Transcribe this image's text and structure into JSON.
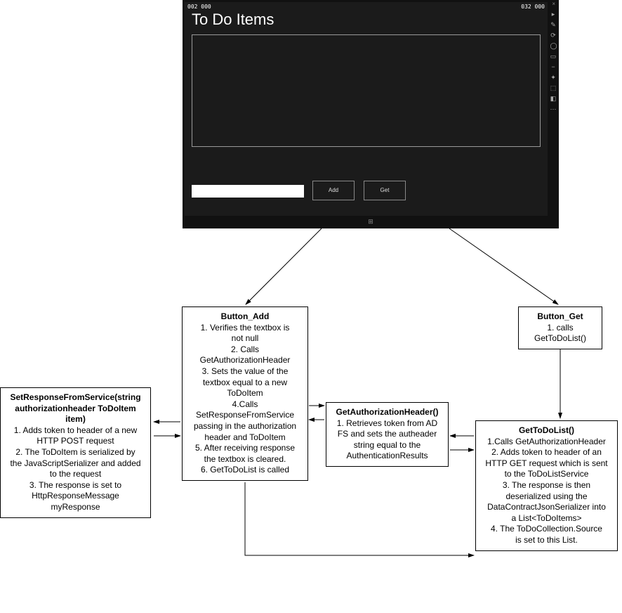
{
  "app": {
    "title": "To Do Items",
    "corner_left": "002   000",
    "corner_right": "032   000",
    "input_value": "",
    "add_label": "Add",
    "get_label": "Get",
    "footer_glyph": "⊞",
    "win_buttons": "—  ×"
  },
  "boxes": {
    "button_add": {
      "title": "Button_Add",
      "l1": "1.  Verifies the textbox is",
      "l2": "not null",
      "l3": "2.  Calls",
      "l4": "GetAuthorizationHeader",
      "l5": "3.  Sets the value of the",
      "l6": "textbox equal to a new",
      "l7": "ToDoItem",
      "l8": "4.Calls",
      "l9": "SetResponseFromService",
      "l10": "passing in the authorization",
      "l11": "header and ToDoItem",
      "l12": "5.  After receiving response",
      "l13": "the textbox is cleared.",
      "l14": "6. GetToDoList is called"
    },
    "button_get": {
      "title": "Button_Get",
      "l1": "1.  calls",
      "l2": "GetToDoList()"
    },
    "set_response": {
      "title1": "SetResponseFromService(string",
      "title2": "authorizationheader ToDoItem",
      "title3": "item)",
      "l1": "1.  Adds token to header of a new",
      "l2": "HTTP POST request",
      "l3": "2.  The ToDoItem is serialized by",
      "l4": "the JavaScriptSerializer and added",
      "l5": "to the request",
      "l6": "3.  The response is set to",
      "l7": "HttpResponseMessage",
      "l8": "myResponse"
    },
    "get_auth": {
      "title": "GetAuthorizationHeader()",
      "l1": "1. Retrieves token from AD",
      "l2": "FS and sets the autheader",
      "l3": "string equal to the",
      "l4": "AuthenticationResults"
    },
    "get_list": {
      "title": "GetToDoList()",
      "l1": "1.Calls GetAuthorizationHeader",
      "l2": "2. Adds token to header of an",
      "l3": "HTTP GET request which is sent",
      "l4": "to the ToDoListService",
      "l5": "3.  The response is then",
      "l6": "deserialized using the",
      "l7": "DataContractJsonSerializer into",
      "l8": "a List<ToDoItems>",
      "l9": "4.  The ToDoCollection.Source",
      "l10": "is set to this List."
    }
  }
}
